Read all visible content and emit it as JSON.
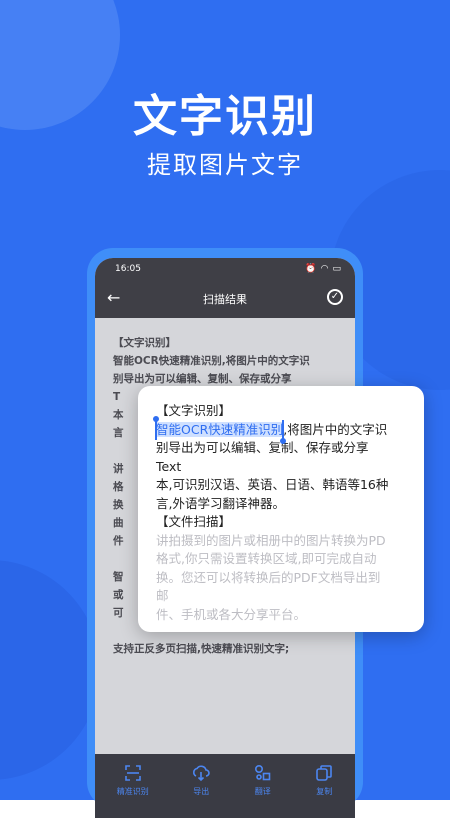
{
  "hero": {
    "title": "文字识别",
    "subtitle": "提取图片文字"
  },
  "phone": {
    "status_time": "16:05",
    "nav_title": "扫描结果",
    "ocr_lines": [
      "【文字识别】",
      "智能OCR快速精准识别,将图片中的文字识",
      "别导出为可以编辑、复制、保存或分享",
      "T",
      "本",
      "言",
      "",
      "讲",
      "格",
      "换",
      "曲",
      "件",
      "",
      "智",
      "或",
      "可",
      "",
      "支持正反多页扫描,快速精准识别文字;"
    ],
    "tabs": [
      {
        "label": "精准识别",
        "icon": "scan-icon"
      },
      {
        "label": "导出",
        "icon": "export-icon"
      },
      {
        "label": "翻译",
        "icon": "translate-icon"
      },
      {
        "label": "复制",
        "icon": "copy-icon"
      }
    ]
  },
  "card": {
    "heading1": "【文字识别】",
    "selected_text": "智能OCR快速精准识别",
    "line1_rest": ",将图片中的文字识",
    "line2": "别导出为可以编辑、复制、保存或分享",
    "line3": "Text",
    "line4": "本,可识别汉语、英语、日语、韩语等16种",
    "line5": "言,外语学习翻译神器。",
    "heading2": "【文件扫描】",
    "faded_lines": [
      "讲拍摄到的图片或相册中的图片转换为PD",
      "格式,你只需设置转换区域,即可完成自动",
      "换。您还可以将转换后的PDF文档导出到",
      "邮",
      "件、手机或各大分享平台。"
    ]
  },
  "colors": {
    "background": "#2f6ef1",
    "accent": "#4c86f0",
    "dark_bar": "#3f3f46"
  }
}
